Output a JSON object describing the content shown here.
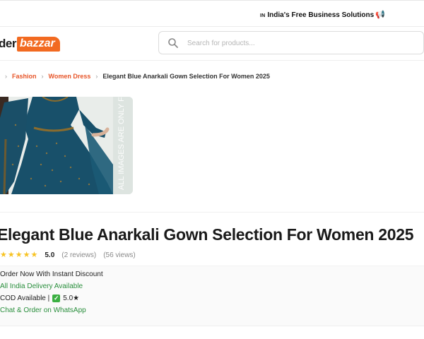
{
  "topbar": {
    "flag": "IN",
    "text": "India's Free Business Solutions",
    "emoji": "📢"
  },
  "header": {
    "logo_part1": "der",
    "logo_part2": "bazzar",
    "search_placeholder": "Search for products..."
  },
  "breadcrumb": {
    "items": [
      "Fashion",
      "Women Dress"
    ],
    "current": "Elegant Blue Anarkali Gown Selection For Women 2025"
  },
  "gallery": {
    "watermark": "ALL IMAGES ARE ONLY FOR"
  },
  "product": {
    "title": "Elegant Blue Anarkali Gown Selection For Women 2025",
    "rating": "5.0",
    "reviews": "(2 reviews)",
    "views": "(56 views)",
    "stars": 5
  },
  "info": {
    "offer": "Order Now With Instant Discount",
    "delivery": "All India Delivery Available",
    "cod": "COD Available |",
    "cod_rating": "5.0★",
    "whatsapp": "Chat & Order on WhatsApp"
  },
  "colors": {
    "accent": "#f26a21",
    "link": "#e7562a",
    "green": "#2a8f3d",
    "star": "#f7c323",
    "gown": "#18506a"
  }
}
